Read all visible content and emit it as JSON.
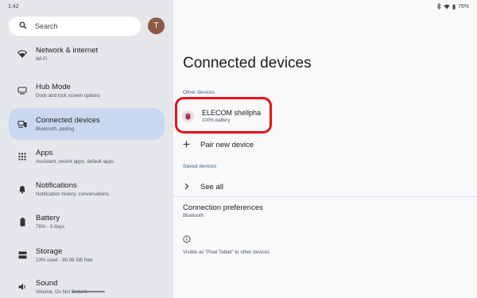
{
  "status": {
    "time": "1:42",
    "battery": "76%"
  },
  "search": {
    "placeholder": "Search"
  },
  "avatar": {
    "initial": "T"
  },
  "sidebar": {
    "items": [
      {
        "title": "Network & internet",
        "subtitle": "Wi-Fi",
        "icon": "wifi-icon"
      },
      {
        "title": "Hub Mode",
        "subtitle": "Dock and lock screen options",
        "icon": "dock-icon"
      },
      {
        "title": "Connected devices",
        "subtitle": "Bluetooth, pairing",
        "icon": "connected-devices-icon"
      },
      {
        "title": "Apps",
        "subtitle": "Assistant, recent apps, default apps",
        "icon": "apps-grid-icon"
      },
      {
        "title": "Notifications",
        "subtitle": "Notification history, conversations",
        "icon": "bell-icon"
      },
      {
        "title": "Battery",
        "subtitle": "76% - 3 days",
        "icon": "battery-icon"
      },
      {
        "title": "Storage",
        "subtitle": "23% used - 99.06 GB free",
        "icon": "storage-icon"
      },
      {
        "title": "Sound",
        "subtitle": "Volume, Do Not Disturb",
        "icon": "volume-icon"
      }
    ],
    "active_index": 2
  },
  "main": {
    "title": "Connected devices",
    "other_devices_label": "Other devices",
    "device": {
      "name": "ELECOM shellpha",
      "status": "100% battery",
      "icon": "mouse-icon"
    },
    "pair_new": "Pair new device",
    "saved_devices_label": "Saved devices",
    "see_all": "See all",
    "connection_preferences": {
      "title": "Connection preferences",
      "subtitle": "Bluetooth"
    },
    "visible_text": "Visible as “Pixel Tablet” to other devices"
  },
  "colors": {
    "active_nav": "#c9d8ee",
    "highlight": "#e8111b",
    "section_label": "#41617f"
  }
}
